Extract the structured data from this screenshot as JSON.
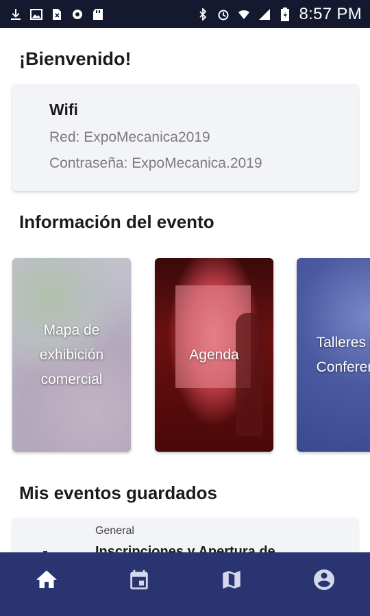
{
  "status_bar": {
    "time": "8:57 PM",
    "left_icons": [
      "download-icon",
      "image-icon",
      "no-sim-icon",
      "settings-icon",
      "sd-card-icon"
    ],
    "right_icons": [
      "bluetooth-icon",
      "alarm-icon",
      "wifi-icon",
      "signal-icon",
      "battery-icon"
    ]
  },
  "welcome": "¡Bienvenido!",
  "wifi_card": {
    "title": "Wifi",
    "network": "Red: ExpoMecanica2019",
    "password": "Contraseña: ExpoMecanica.2019"
  },
  "info_section": {
    "title": "Información del evento",
    "cards": [
      {
        "label_lines": [
          "Mapa de",
          "exhibición",
          "comercial"
        ]
      },
      {
        "label_lines": [
          "Agenda"
        ]
      },
      {
        "label_lines": [
          "Talleres y",
          "Conferencias"
        ]
      }
    ]
  },
  "saved_section": {
    "title": "Mis eventos guardados",
    "items": [
      {
        "category": "General",
        "title": "Inscripciones y Apertura de"
      }
    ]
  },
  "bottom_nav": {
    "items": [
      "home-icon",
      "calendar-icon",
      "map-icon",
      "account-icon"
    ],
    "active_color": "#ffffff",
    "background": "#2a3470"
  }
}
